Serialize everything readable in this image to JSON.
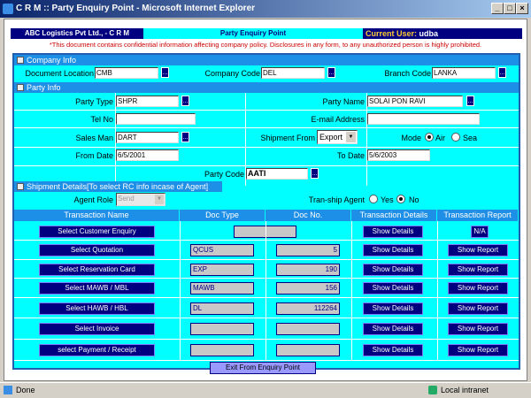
{
  "window": {
    "title": "C R M :: Party Enquiry Point - Microsoft Internet Explorer",
    "min": "_",
    "max": "□",
    "close": "×"
  },
  "header": {
    "company": "ABC Logistics Pvt Ltd., - C R M",
    "page_title": "Party Enquiry Point",
    "user_label": "Current User:",
    "user": "udba"
  },
  "notice": "*This document contains confidential information affecting company policy. Disclosures in any form, to any unauthorized person is highly prohibited.",
  "company_info": {
    "title": "Company Info",
    "doc_location_label": "Document Location",
    "doc_location": "CMB",
    "company_code_label": "Company Code",
    "company_code": "DEL",
    "branch_code_label": "Branch Code",
    "branch_code": "LANKA",
    "lookup": "..."
  },
  "party_info": {
    "title": "Party Info",
    "party_type_label": "Party Type",
    "party_type": "SHPR",
    "party_name_label": "Party Name",
    "party_name": "SOLAI PON RAVI",
    "tel_label": "Tel No",
    "tel": "",
    "email_label": "E-mail Address",
    "email": "",
    "sales_man_label": "Sales Man",
    "sales_man": "DART",
    "shipment_from_label": "Shipment From",
    "shipment_from": "Export",
    "mode_label": "Mode",
    "mode_air": "Air",
    "mode_sea": "Sea",
    "mode_selected": "Air",
    "from_date_label": "From Date",
    "from_date": "6/5/2001",
    "to_date_label": "To Date",
    "to_date": "5/6/2003",
    "party_code_label": "Party Code",
    "party_code": "AATI"
  },
  "shipment": {
    "title": "Shipment Details[To select RC info incase of Agent]",
    "agent_role_label": "Agent Role",
    "agent_role": "Send",
    "tranship_label": "Tran-ship Agent",
    "yes": "Yes",
    "no": "No",
    "tranship_selected": "No"
  },
  "table": {
    "headers": [
      "Transaction Name",
      "Doc Type",
      "Doc No.",
      "Transaction Details",
      "Transaction Report"
    ],
    "rows": [
      {
        "name": "Select Customer Enquiry",
        "doc_type": "",
        "doc_no": "",
        "details": "Show Details",
        "report": "N/A"
      },
      {
        "name": "Select  Quotation",
        "doc_type": "QCUS",
        "doc_no": "5",
        "details": "Show Details",
        "report": "Show Report"
      },
      {
        "name": "Select  Reservation Card",
        "doc_type": "EXP",
        "doc_no": "190",
        "details": "Show Details",
        "report": "Show Report"
      },
      {
        "name": "Select MAWB / MBL",
        "doc_type": "MAWB",
        "doc_no": "156",
        "details": "Show Details",
        "report": "Show Report"
      },
      {
        "name": "Select HAWB /  HBL",
        "doc_type": "DL",
        "doc_no": "112264",
        "details": "Show Details",
        "report": "Show Report"
      },
      {
        "name": "Select  Invoice",
        "doc_type": "",
        "doc_no": "",
        "details": "Show Details",
        "report": "Show Report"
      },
      {
        "name": "select Payment / Receipt",
        "doc_type": "",
        "doc_no": "",
        "details": "Show Details",
        "report": "Show Report"
      }
    ]
  },
  "exit_button": "Exit From Enquiry Point",
  "status": {
    "text": "Done",
    "zone": "Local intranet"
  }
}
